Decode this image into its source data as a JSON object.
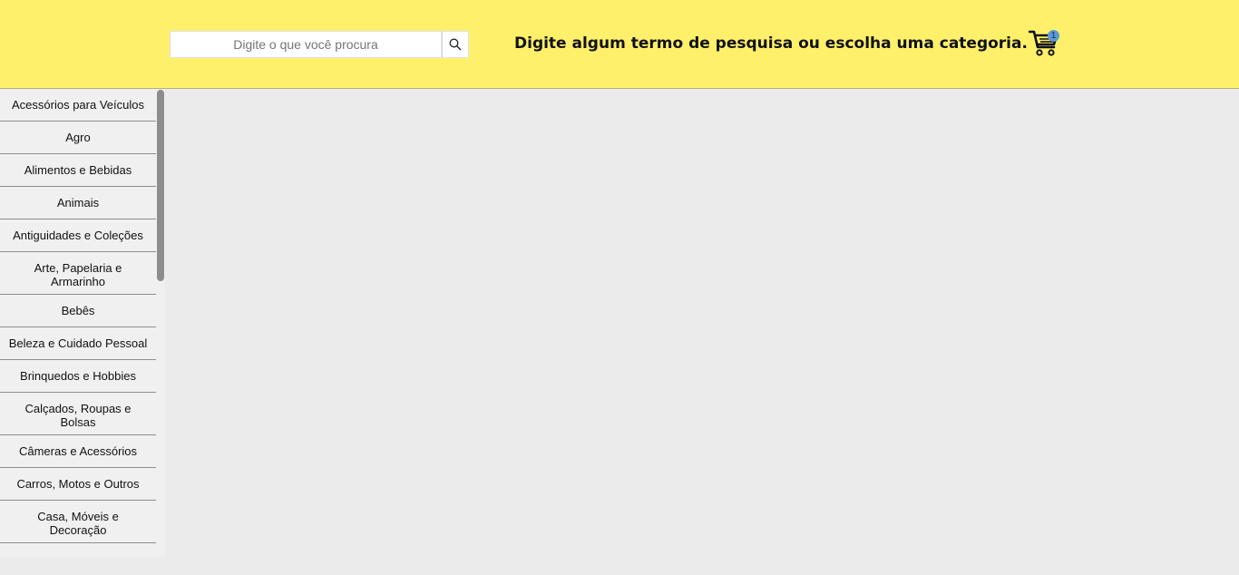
{
  "search": {
    "placeholder": "Digite o que você procura",
    "button_icon": "search-icon"
  },
  "header": {
    "headline": "Digite algum termo de pesquisa ou escolha uma categoria.",
    "background_color": "#fff06c"
  },
  "cart": {
    "icon": "cart-icon",
    "count": "1",
    "badge_color": "#5b9bd5"
  },
  "sidebar": {
    "items": [
      {
        "label": "Acessórios para Veículos"
      },
      {
        "label": "Agro"
      },
      {
        "label": "Alimentos e Bebidas"
      },
      {
        "label": "Animais"
      },
      {
        "label": "Antiguidades e Coleções"
      },
      {
        "label": "Arte, Papelaria e Armarinho"
      },
      {
        "label": "Bebês"
      },
      {
        "label": "Beleza e Cuidado Pessoal"
      },
      {
        "label": "Brinquedos e Hobbies"
      },
      {
        "label": "Calçados, Roupas e Bolsas"
      },
      {
        "label": "Câmeras e Acessórios"
      },
      {
        "label": "Carros, Motos e Outros"
      },
      {
        "label": "Casa, Móveis e Decoração"
      }
    ]
  }
}
